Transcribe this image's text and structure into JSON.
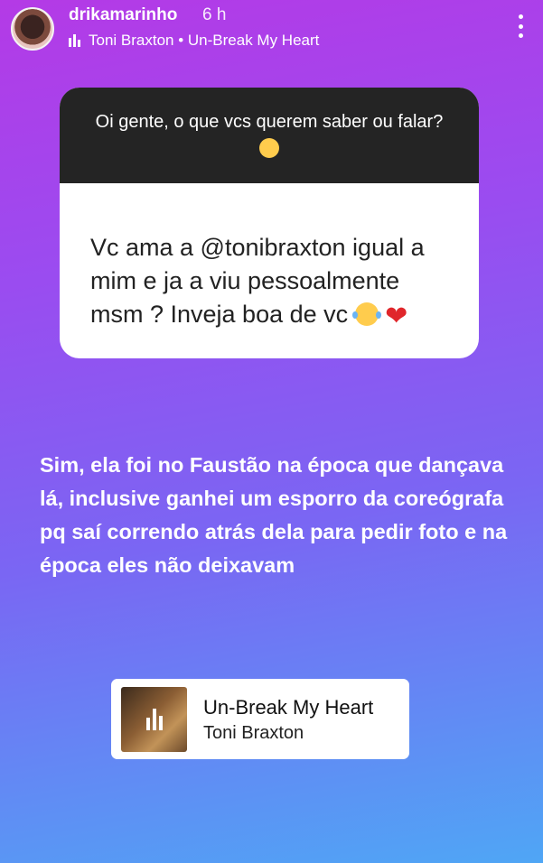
{
  "header": {
    "username": "drikamarinho",
    "time": "6 h",
    "music": "Toni Braxton • Un-Break My Heart"
  },
  "question_sticker": {
    "prompt": "Oi gente, o que vcs querem saber ou falar?",
    "response": "Vc ama a @tonibraxton igual a mim e ja a viu pessoalmente msm ? Inveja boa de vc"
  },
  "answer_text": "Sim, ela foi no Faustão na época que dançava lá, inclusive ganhei um esporro da coreógrafa pq saí correndo atrás dela para pedir foto e na época eles não deixavam",
  "music_sticker": {
    "title": "Un-Break My Heart",
    "artist": "Toni Braxton"
  },
  "icons": [
    "music-bars-icon",
    "more-options-icon",
    "smiling-face-icon",
    "laughing-tears-icon",
    "red-heart-icon"
  ],
  "colors": {
    "question_header": "#242424",
    "heart": "#e0262b"
  }
}
